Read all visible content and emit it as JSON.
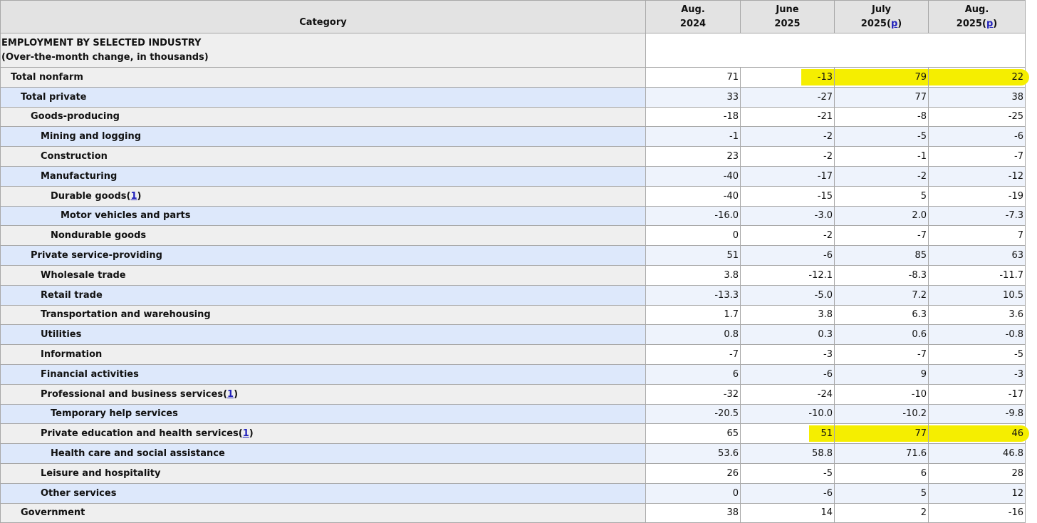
{
  "table": {
    "category_header": "Category",
    "columns": [
      {
        "line1": "Aug.",
        "line2": "2024",
        "footnote": ""
      },
      {
        "line1": "June",
        "line2": "2025",
        "footnote": ""
      },
      {
        "line1": "July",
        "line2": "2025",
        "footnote": "p"
      },
      {
        "line1": "Aug.",
        "line2": "2025",
        "footnote": "p"
      }
    ],
    "section": {
      "title": "EMPLOYMENT BY SELECTED INDUSTRY",
      "subtitle": "(Over-the-month change, in thousands)"
    },
    "rows": [
      {
        "label": "Total nonfarm",
        "footnote": "",
        "values": [
          "71",
          "-13",
          "79",
          "22"
        ],
        "highlighted": [
          false,
          true,
          true,
          true
        ]
      },
      {
        "label": "Total private",
        "footnote": "",
        "values": [
          "33",
          "-27",
          "77",
          "38"
        ]
      },
      {
        "label": "Goods-producing",
        "footnote": "",
        "values": [
          "-18",
          "-21",
          "-8",
          "-25"
        ]
      },
      {
        "label": "Mining and logging",
        "footnote": "",
        "values": [
          "-1",
          "-2",
          "-5",
          "-6"
        ]
      },
      {
        "label": "Construction",
        "footnote": "",
        "values": [
          "23",
          "-2",
          "-1",
          "-7"
        ]
      },
      {
        "label": "Manufacturing",
        "footnote": "",
        "values": [
          "-40",
          "-17",
          "-2",
          "-12"
        ]
      },
      {
        "label": "Durable goods",
        "footnote": "1",
        "values": [
          "-40",
          "-15",
          "5",
          "-19"
        ]
      },
      {
        "label": "Motor vehicles and parts",
        "footnote": "",
        "values": [
          "-16.0",
          "-3.0",
          "2.0",
          "-7.3"
        ]
      },
      {
        "label": "Nondurable goods",
        "footnote": "",
        "values": [
          "0",
          "-2",
          "-7",
          "7"
        ]
      },
      {
        "label": "Private service-providing",
        "footnote": "",
        "values": [
          "51",
          "-6",
          "85",
          "63"
        ]
      },
      {
        "label": "Wholesale trade",
        "footnote": "",
        "values": [
          "3.8",
          "-12.1",
          "-8.3",
          "-11.7"
        ]
      },
      {
        "label": "Retail trade",
        "footnote": "",
        "values": [
          "-13.3",
          "-5.0",
          "7.2",
          "10.5"
        ]
      },
      {
        "label": "Transportation and warehousing",
        "footnote": "",
        "values": [
          "1.7",
          "3.8",
          "6.3",
          "3.6"
        ]
      },
      {
        "label": "Utilities",
        "footnote": "",
        "values": [
          "0.8",
          "0.3",
          "0.6",
          "-0.8"
        ]
      },
      {
        "label": "Information",
        "footnote": "",
        "values": [
          "-7",
          "-3",
          "-7",
          "-5"
        ]
      },
      {
        "label": "Financial activities",
        "footnote": "",
        "values": [
          "6",
          "-6",
          "9",
          "-3"
        ]
      },
      {
        "label": "Professional and business services",
        "footnote": "1",
        "values": [
          "-32",
          "-24",
          "-10",
          "-17"
        ]
      },
      {
        "label": "Temporary help services",
        "footnote": "",
        "values": [
          "-20.5",
          "-10.0",
          "-10.2",
          "-9.8"
        ]
      },
      {
        "label": "Private education and health services",
        "footnote": "1",
        "values": [
          "65",
          "51",
          "77",
          "46"
        ],
        "highlighted": [
          false,
          true,
          true,
          true
        ]
      },
      {
        "label": "Health care and social assistance",
        "footnote": "",
        "values": [
          "53.6",
          "58.8",
          "71.6",
          "46.8"
        ]
      },
      {
        "label": "Leisure and hospitality",
        "footnote": "",
        "values": [
          "26",
          "-5",
          "6",
          "28"
        ]
      },
      {
        "label": "Other services",
        "footnote": "",
        "values": [
          "0",
          "-6",
          "5",
          "12"
        ]
      },
      {
        "label": "Government",
        "footnote": "",
        "values": [
          "38",
          "14",
          "2",
          "-16"
        ]
      }
    ]
  },
  "colors": {
    "highlight": "#f5ee00",
    "header_bg": "#e3e3e3",
    "row_blue_label": "#dde8fb",
    "row_blue_value": "#eef3fc",
    "row_gray_label": "#efefef",
    "footnote_link": "#2222bb"
  }
}
